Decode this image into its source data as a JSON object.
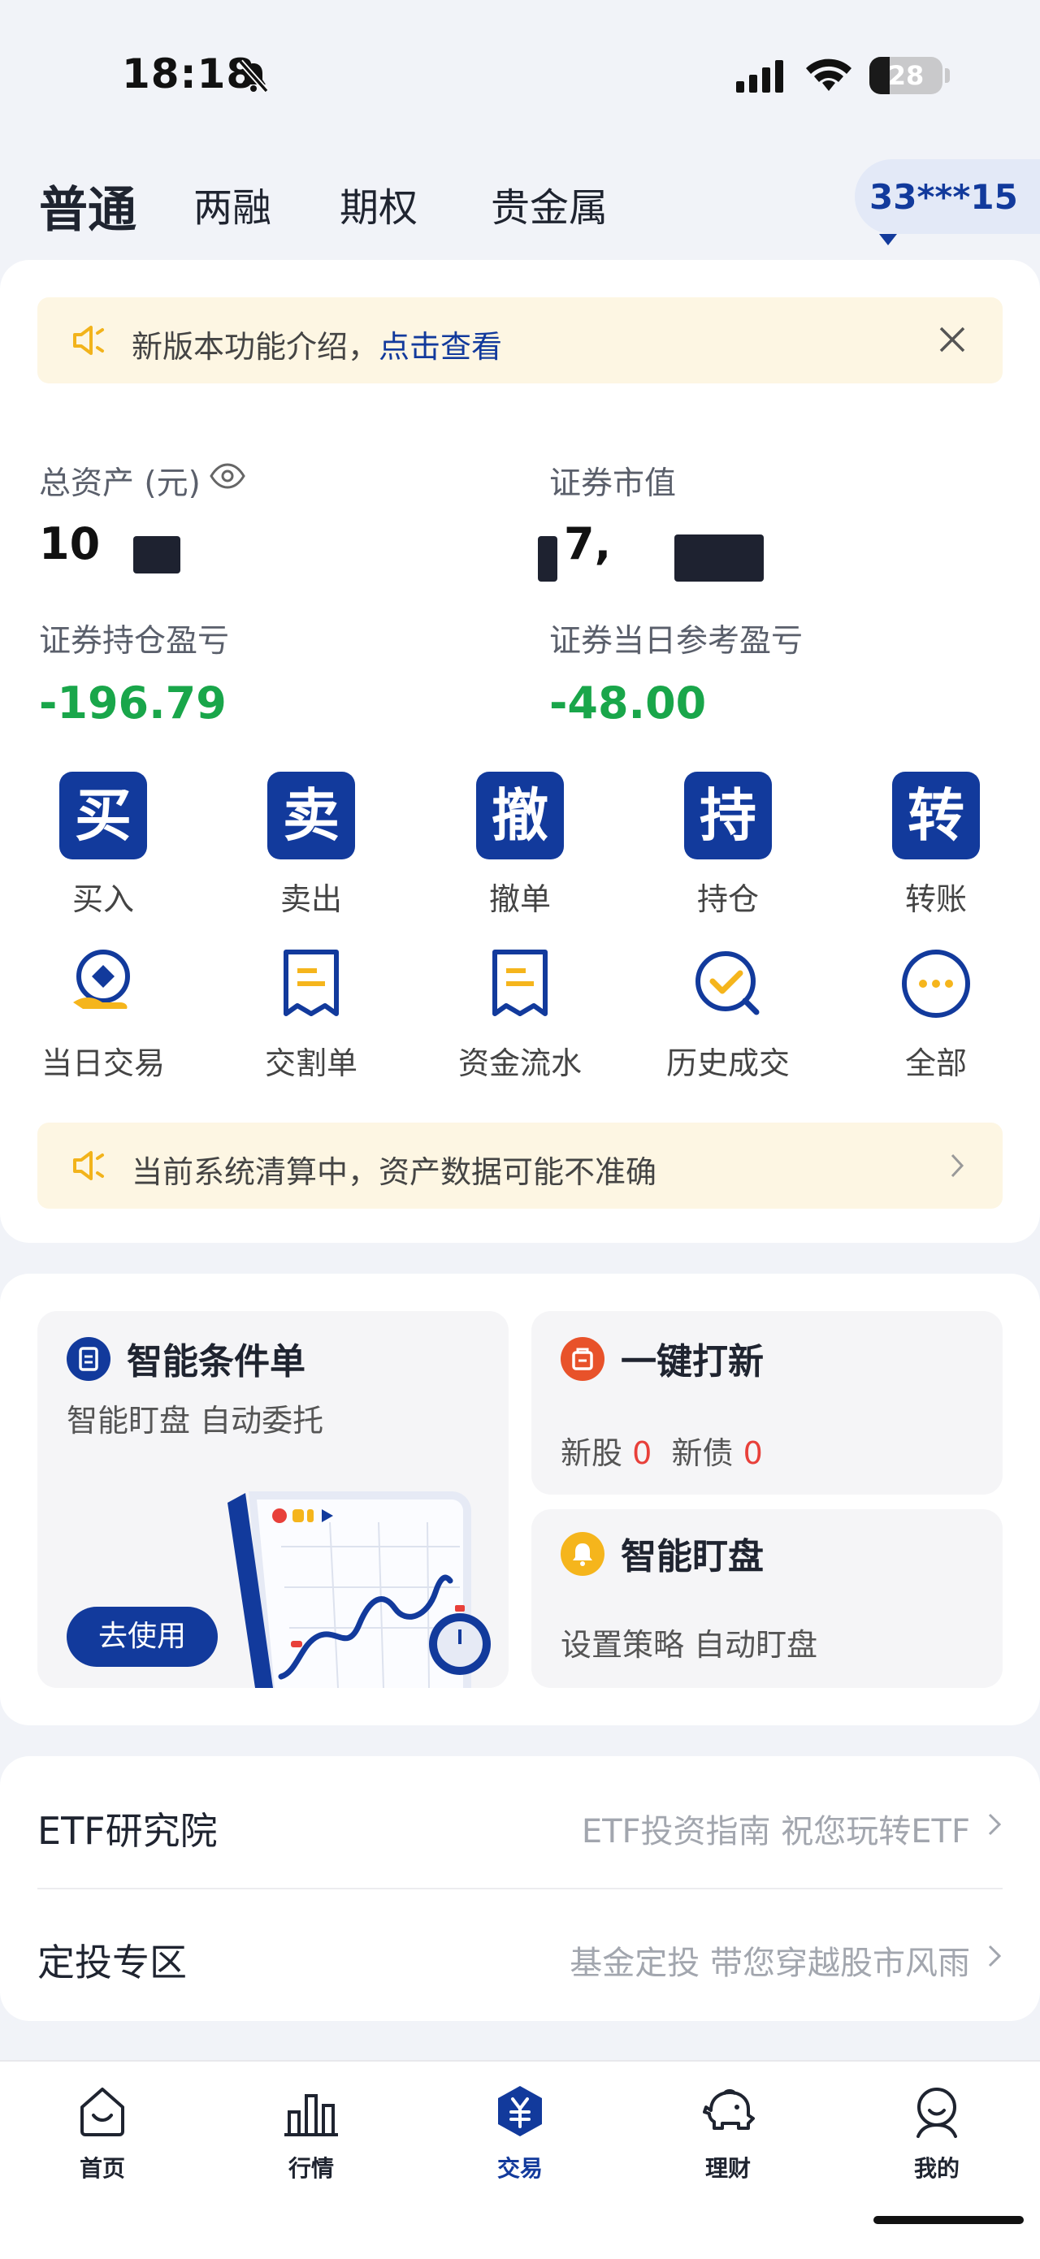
{
  "status": {
    "time": "18:18",
    "battery": "28",
    "battery_level": 0.28
  },
  "tabs": [
    {
      "label": "普通",
      "active": true
    },
    {
      "label": "两融"
    },
    {
      "label": "期权"
    },
    {
      "label": "贵金属"
    }
  ],
  "account": {
    "label": "33***15"
  },
  "notice_top": {
    "text": "新版本功能介绍，",
    "link": "点击查看"
  },
  "assets": {
    "total_label": "总资产 (元)",
    "total_value": "10",
    "market_label": "证券市值",
    "market_value": "7,",
    "holding_pl_label": "证券持仓盈亏",
    "holding_pl_value": "-196.79",
    "daily_pl_label": "证券当日参考盈亏",
    "daily_pl_value": "-48.00"
  },
  "actions": [
    {
      "glyph": "买",
      "label": "买入"
    },
    {
      "glyph": "卖",
      "label": "卖出"
    },
    {
      "glyph": "撤",
      "label": "撤单"
    },
    {
      "glyph": "持",
      "label": "持仓"
    },
    {
      "glyph": "转",
      "label": "转账"
    }
  ],
  "actions2": [
    {
      "icon": "daily-trade-icon",
      "label": "当日交易"
    },
    {
      "icon": "settlement-icon",
      "label": "交割单"
    },
    {
      "icon": "cashflow-icon",
      "label": "资金流水"
    },
    {
      "icon": "history-icon",
      "label": "历史成交"
    },
    {
      "icon": "more-icon",
      "label": "全部"
    }
  ],
  "notice_bottom": {
    "text": "当前系统清算中，资产数据可能不准确"
  },
  "features": {
    "condition_order": {
      "title": "智能条件单",
      "subtitle": "智能盯盘 自动委托",
      "button": "去使用"
    },
    "ipo": {
      "title": "一键打新",
      "stock_label": "新股",
      "stock_count": "0",
      "bond_label": "新债",
      "bond_count": "0"
    },
    "monitor": {
      "title": "智能盯盘",
      "subtitle": "设置策略 自动盯盘"
    }
  },
  "rows": [
    {
      "label": "ETF研究院",
      "desc": "ETF投资指南 祝您玩转ETF"
    },
    {
      "label": "定投专区",
      "desc": "基金定投 带您穿越股市风雨"
    }
  ],
  "nav": [
    {
      "icon": "home-icon",
      "label": "首页"
    },
    {
      "icon": "market-icon",
      "label": "行情"
    },
    {
      "icon": "trade-icon",
      "label": "交易",
      "active": true
    },
    {
      "icon": "wealth-icon",
      "label": "理财"
    },
    {
      "icon": "profile-icon",
      "label": "我的"
    }
  ],
  "colors": {
    "brand": "#123a9c",
    "loss": "#19a64a",
    "alert": "#e8403a",
    "notice_bg": "#fdf6e3"
  }
}
